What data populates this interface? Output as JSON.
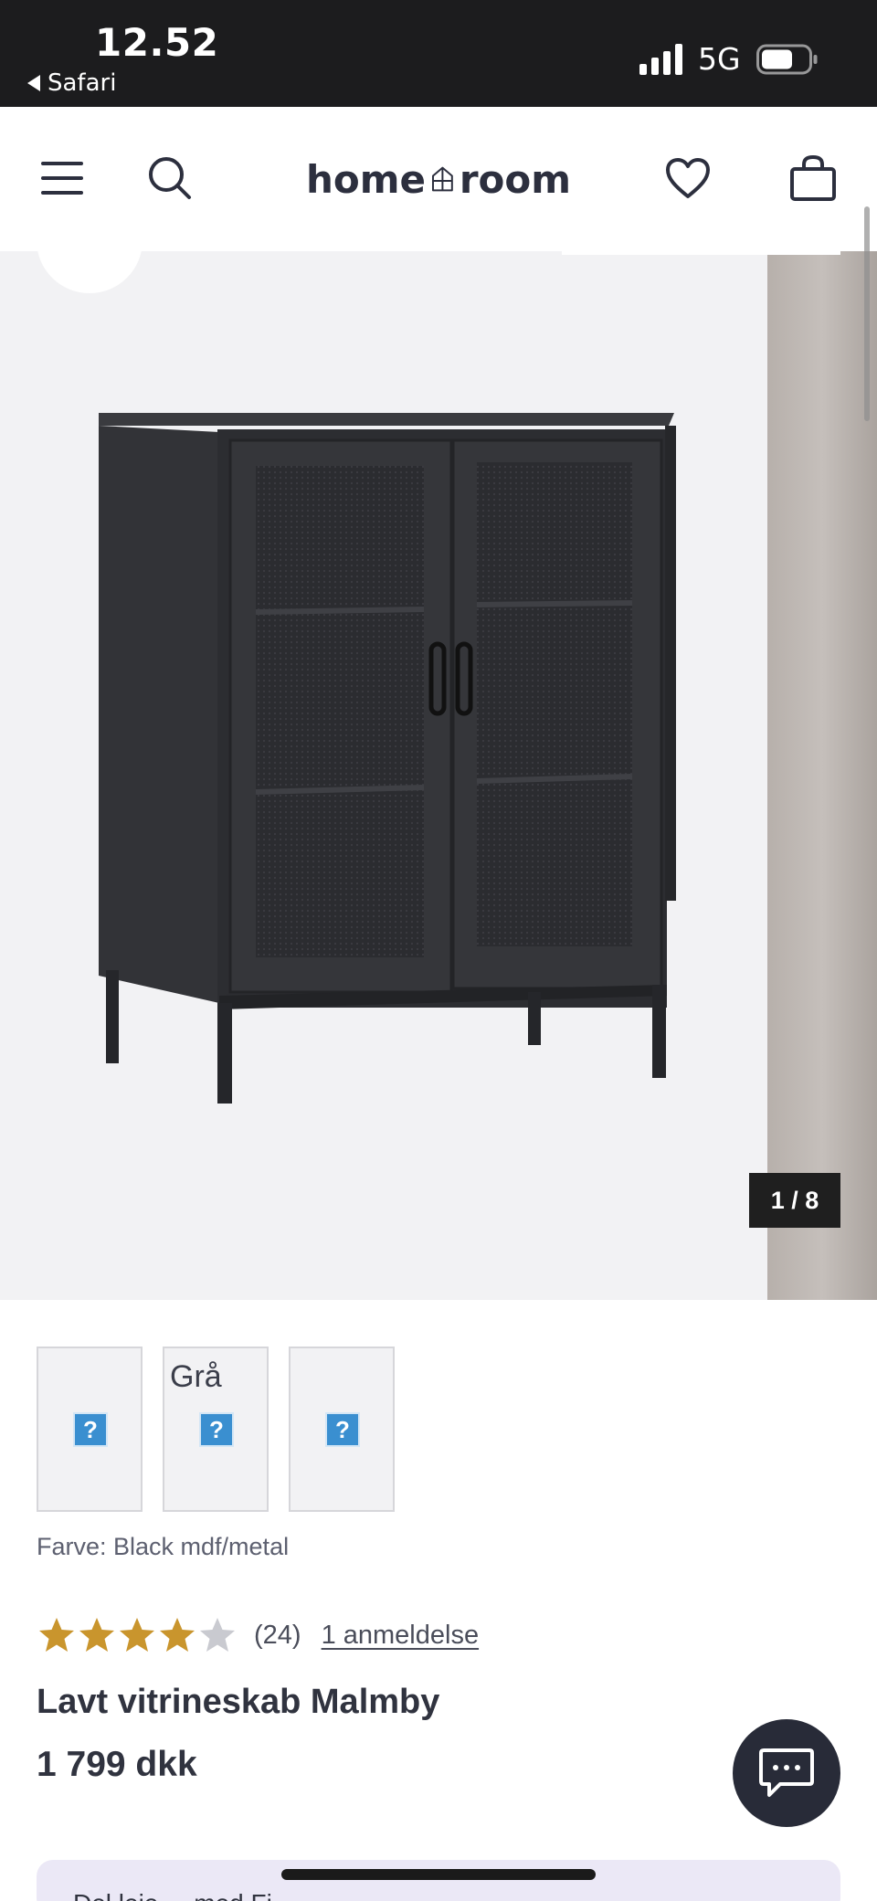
{
  "status_bar": {
    "time": "12.52",
    "back_app": "Safari",
    "network": "5G"
  },
  "header": {
    "logo_left": "home",
    "logo_right": "room",
    "icons": [
      "menu-icon",
      "search-icon",
      "heart-icon",
      "shopping-bag-icon"
    ]
  },
  "gallery": {
    "counter": "1 / 8",
    "current_index": 1,
    "total": 8
  },
  "thumbnails": [
    {
      "label": "",
      "icon": "broken-image-icon"
    },
    {
      "label": "Grå",
      "icon": "broken-image-icon"
    },
    {
      "label": "",
      "icon": "broken-image-icon"
    }
  ],
  "product": {
    "color_label": "Farve: Black mdf/metal",
    "rating_value": 4,
    "rating_max": 5,
    "rating_count": "(24)",
    "review_link": "1 anmeldelse",
    "name": "Lavt vitrineskab Malmby",
    "price": "1 799 dkk"
  },
  "promo": {
    "text": "Del leje ... med Fi..."
  },
  "colors": {
    "status_bg": "#1c1c1e",
    "star_filled": "#c9952d",
    "star_empty": "#c9cad0",
    "chat_bg": "#282b38",
    "promo_bg": "#ebe8f6"
  }
}
